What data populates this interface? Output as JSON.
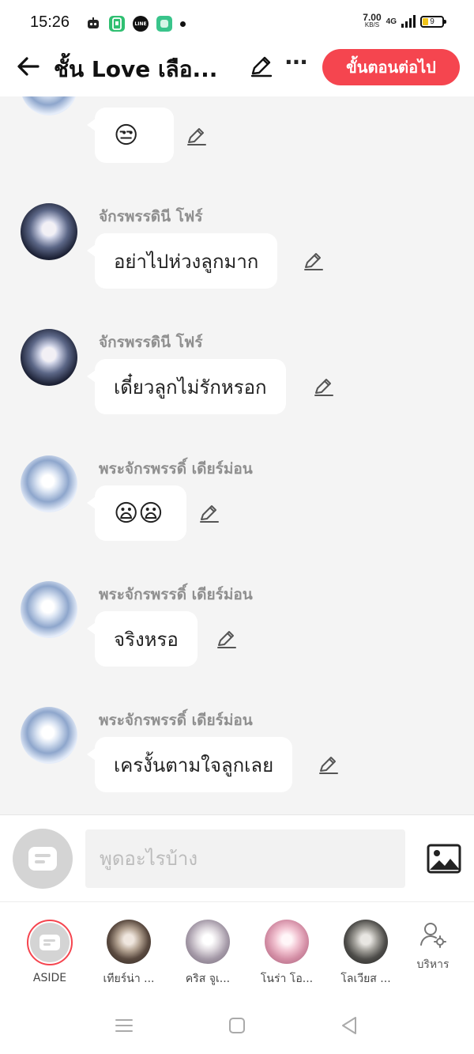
{
  "status_bar": {
    "time": "15:26",
    "net_speed": "7.00",
    "net_unit": "KB/S",
    "network": "4G",
    "battery": "9",
    "app_icons": [
      "robot-app-icon",
      "phone-clipboard-app-icon",
      "line-app-icon",
      "green-square-app-icon"
    ]
  },
  "header": {
    "title": "ชั้น Love เลือ...",
    "more": "···",
    "next_label": "ขั้นตอนต่อไป"
  },
  "messages": [
    {
      "sender": "",
      "text": "😒",
      "is_emoji": true,
      "avatar": "light"
    },
    {
      "sender": "จักรพรรดินี โฟร์",
      "text": "อย่าไปห่วงลูกมาก",
      "is_emoji": false,
      "avatar": "dark"
    },
    {
      "sender": "จักรพรรดินี โฟร์",
      "text": "เดี๋ยวลูกไม่รักหรอก",
      "is_emoji": false,
      "avatar": "dark"
    },
    {
      "sender": "พระจักรพรรดิ์ เดียร์ม่อน",
      "text": "😦😦",
      "is_emoji": true,
      "avatar": "light"
    },
    {
      "sender": "พระจักรพรรดิ์ เดียร์ม่อน",
      "text": "จริงหรอ",
      "is_emoji": false,
      "avatar": "light"
    },
    {
      "sender": "พระจักรพรรดิ์ เดียร์ม่อน",
      "text": "เครงั้นตามใจลูกเลย",
      "is_emoji": false,
      "avatar": "light"
    }
  ],
  "composer": {
    "placeholder": "พูดอะไรบ้าง",
    "value": ""
  },
  "characters": [
    {
      "name": "ASIDE"
    },
    {
      "name": "เทียร์น่า ..."
    },
    {
      "name": "คริส จูเ..."
    },
    {
      "name": "โนร่า โอ..."
    },
    {
      "name": "โลเวียส ..."
    }
  ],
  "manage_label": "บริหาร",
  "colors": {
    "accent": "#f5454f",
    "background": "#f4f4f4",
    "bubble": "#ffffff",
    "sender_text": "#8f8f8f"
  }
}
